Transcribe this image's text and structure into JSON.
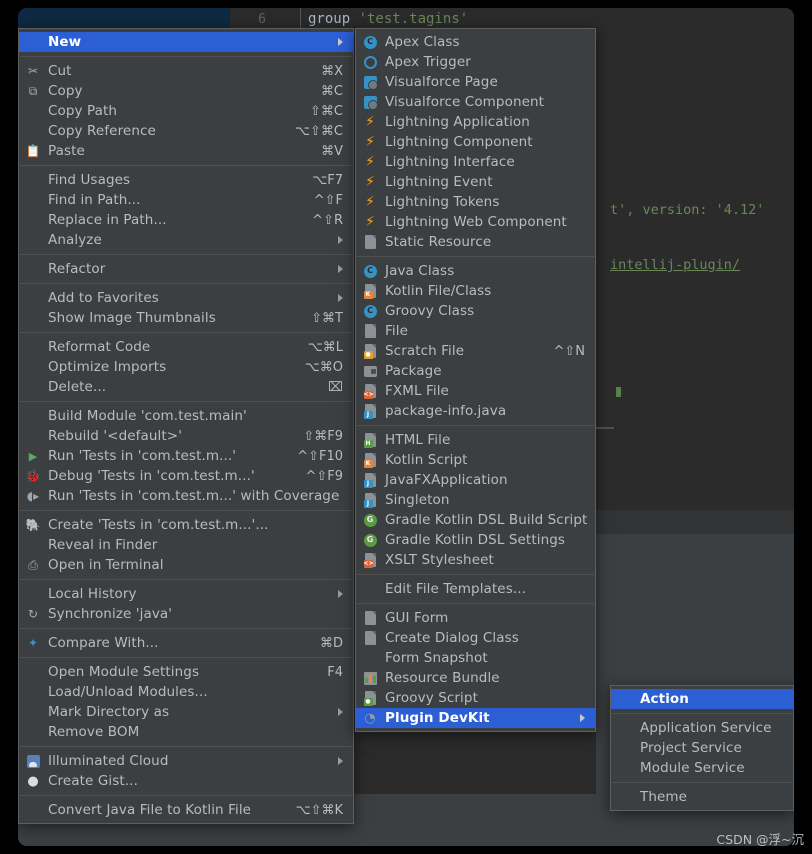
{
  "editor": {
    "top_line_number": "6",
    "top_code_prefix": "group ",
    "top_code_string": "'test.tagins'",
    "code_line_1": "t', version: '4.12'",
    "code_link": "intellij-plugin/"
  },
  "watermark": "CSDN @浮~沉",
  "colors": {
    "menu_bg": "#3c3f41",
    "menu_border": "#5e6060",
    "highlight": "#2d5fd4",
    "text": "#bbbbbb",
    "text_selected": "#ffffff",
    "separator": "#515151",
    "editor_bg": "#2b2b2b",
    "string_green": "#6a8759",
    "icon_blue": "#3592c4",
    "icon_orange": "#f5a623",
    "icon_green": "#59a869"
  },
  "context_menu": {
    "groups": [
      {
        "items": [
          {
            "label": "New",
            "icon": "none",
            "accel": "",
            "submenu": true,
            "selected": true
          }
        ]
      },
      {
        "items": [
          {
            "label": "Cut",
            "icon": "scissors-icon",
            "accel": "⌘X",
            "submenu": false
          },
          {
            "label": "Copy",
            "icon": "copy-icon",
            "accel": "⌘C",
            "submenu": false
          },
          {
            "label": "Copy Path",
            "icon": "none",
            "accel": "⇧⌘C",
            "submenu": false
          },
          {
            "label": "Copy Reference",
            "icon": "none",
            "accel": "⌥⇧⌘C",
            "submenu": false
          },
          {
            "label": "Paste",
            "icon": "paste-icon",
            "accel": "⌘V",
            "submenu": false
          }
        ]
      },
      {
        "items": [
          {
            "label": "Find Usages",
            "icon": "none",
            "accel": "⌥F7",
            "submenu": false
          },
          {
            "label": "Find in Path...",
            "icon": "none",
            "accel": "^⇧F",
            "submenu": false
          },
          {
            "label": "Replace in Path...",
            "icon": "none",
            "accel": "^⇧R",
            "submenu": false
          },
          {
            "label": "Analyze",
            "icon": "none",
            "accel": "",
            "submenu": true
          }
        ]
      },
      {
        "items": [
          {
            "label": "Refactor",
            "icon": "none",
            "accel": "",
            "submenu": true
          }
        ]
      },
      {
        "items": [
          {
            "label": "Add to Favorites",
            "icon": "none",
            "accel": "",
            "submenu": true
          },
          {
            "label": "Show Image Thumbnails",
            "icon": "none",
            "accel": "⇧⌘T",
            "submenu": false
          }
        ]
      },
      {
        "items": [
          {
            "label": "Reformat Code",
            "icon": "none",
            "accel": "⌥⌘L",
            "submenu": false
          },
          {
            "label": "Optimize Imports",
            "icon": "none",
            "accel": "⌥⌘O",
            "submenu": false
          },
          {
            "label": "Delete...",
            "icon": "none",
            "accel": "⌧",
            "submenu": false
          }
        ]
      },
      {
        "items": [
          {
            "label": "Build Module 'com.test.main'",
            "icon": "none",
            "accel": "",
            "submenu": false
          },
          {
            "label": "Rebuild '<default>'",
            "icon": "none",
            "accel": "⇧⌘F9",
            "submenu": false
          },
          {
            "label": "Run 'Tests in 'com.test.m...'",
            "icon": "run-icon",
            "accel": "^⇧F10",
            "submenu": false
          },
          {
            "label": "Debug 'Tests in 'com.test.m...'",
            "icon": "debug-icon",
            "accel": "^⇧F9",
            "submenu": false
          },
          {
            "label": "Run 'Tests in 'com.test.m...' with Coverage",
            "icon": "coverage-icon",
            "accel": "",
            "submenu": false
          }
        ]
      },
      {
        "items": [
          {
            "label": "Create 'Tests in 'com.test.m...'...",
            "icon": "gradle-icon",
            "accel": "",
            "submenu": false
          },
          {
            "label": "Reveal in Finder",
            "icon": "none",
            "accel": "",
            "submenu": false
          },
          {
            "label": "Open in Terminal",
            "icon": "terminal-icon",
            "accel": "",
            "submenu": false
          }
        ]
      },
      {
        "items": [
          {
            "label": "Local History",
            "icon": "none",
            "accel": "",
            "submenu": true
          },
          {
            "label": "Synchronize 'java'",
            "icon": "sync-icon",
            "accel": "",
            "submenu": false
          }
        ]
      },
      {
        "items": [
          {
            "label": "Compare With...",
            "icon": "compare-icon",
            "accel": "⌘D",
            "submenu": false
          }
        ]
      },
      {
        "items": [
          {
            "label": "Open Module Settings",
            "icon": "none",
            "accel": "F4",
            "submenu": false
          },
          {
            "label": "Load/Unload Modules...",
            "icon": "none",
            "accel": "",
            "submenu": false
          },
          {
            "label": "Mark Directory as",
            "icon": "none",
            "accel": "",
            "submenu": true
          },
          {
            "label": "Remove BOM",
            "icon": "none",
            "accel": "",
            "submenu": false
          }
        ]
      },
      {
        "items": [
          {
            "label": "Illuminated Cloud",
            "icon": "cloud-icon",
            "accel": "",
            "submenu": true
          },
          {
            "label": "Create Gist...",
            "icon": "github-icon",
            "accel": "",
            "submenu": false
          }
        ]
      },
      {
        "items": [
          {
            "label": "Convert Java File to Kotlin File",
            "icon": "none",
            "accel": "⌥⇧⌘K",
            "submenu": false
          }
        ]
      }
    ]
  },
  "new_menu": {
    "groups": [
      {
        "items": [
          {
            "label": "Apex Class",
            "icon": "apex-class-icon",
            "accel": "",
            "submenu": false
          },
          {
            "label": "Apex Trigger",
            "icon": "apex-trigger-icon",
            "accel": "",
            "submenu": false
          },
          {
            "label": "Visualforce Page",
            "icon": "visualforce-icon",
            "accel": "",
            "submenu": false
          },
          {
            "label": "Visualforce Component",
            "icon": "visualforce-icon",
            "accel": "",
            "submenu": false
          },
          {
            "label": "Lightning Application",
            "icon": "lightning-icon",
            "accel": "",
            "submenu": false
          },
          {
            "label": "Lightning Component",
            "icon": "lightning-icon",
            "accel": "",
            "submenu": false
          },
          {
            "label": "Lightning Interface",
            "icon": "lightning-icon",
            "accel": "",
            "submenu": false
          },
          {
            "label": "Lightning Event",
            "icon": "lightning-icon",
            "accel": "",
            "submenu": false
          },
          {
            "label": "Lightning Tokens",
            "icon": "lightning-icon",
            "accel": "",
            "submenu": false
          },
          {
            "label": "Lightning Web Component",
            "icon": "lightning-icon",
            "accel": "",
            "submenu": false
          },
          {
            "label": "Static Resource",
            "icon": "static-resource-icon",
            "accel": "",
            "submenu": false
          }
        ]
      },
      {
        "items": [
          {
            "label": "Java Class",
            "icon": "java-class-icon",
            "accel": "",
            "submenu": false
          },
          {
            "label": "Kotlin File/Class",
            "icon": "kotlin-file-icon",
            "accel": "",
            "submenu": false
          },
          {
            "label": "Groovy Class",
            "icon": "groovy-class-icon",
            "accel": "",
            "submenu": false
          },
          {
            "label": "File",
            "icon": "file-icon",
            "accel": "",
            "submenu": false
          },
          {
            "label": "Scratch File",
            "icon": "scratch-file-icon",
            "accel": "^⇧N",
            "submenu": false
          },
          {
            "label": "Package",
            "icon": "package-icon",
            "accel": "",
            "submenu": false
          },
          {
            "label": "FXML File",
            "icon": "fxml-file-icon",
            "accel": "",
            "submenu": false
          },
          {
            "label": "package-info.java",
            "icon": "java-file-icon",
            "accel": "",
            "submenu": false
          }
        ]
      },
      {
        "items": [
          {
            "label": "HTML File",
            "icon": "html-file-icon",
            "accel": "",
            "submenu": false
          },
          {
            "label": "Kotlin Script",
            "icon": "kotlin-script-icon",
            "accel": "",
            "submenu": false
          },
          {
            "label": "JavaFXApplication",
            "icon": "java-file-icon",
            "accel": "",
            "submenu": false
          },
          {
            "label": "Singleton",
            "icon": "java-file-icon",
            "accel": "",
            "submenu": false
          },
          {
            "label": "Gradle Kotlin DSL Build Script",
            "icon": "gradle-green-icon",
            "accel": "",
            "submenu": false
          },
          {
            "label": "Gradle Kotlin DSL Settings",
            "icon": "gradle-green-icon",
            "accel": "",
            "submenu": false
          },
          {
            "label": "XSLT Stylesheet",
            "icon": "xslt-file-icon",
            "accel": "",
            "submenu": false
          }
        ]
      },
      {
        "items": [
          {
            "label": "Edit File Templates...",
            "icon": "none",
            "accel": "",
            "submenu": false
          }
        ]
      },
      {
        "items": [
          {
            "label": "GUI Form",
            "icon": "gui-form-icon",
            "accel": "",
            "submenu": false
          },
          {
            "label": "Create Dialog Class",
            "icon": "gui-form-icon",
            "accel": "",
            "submenu": false
          },
          {
            "label": "Form Snapshot",
            "icon": "none",
            "accel": "",
            "submenu": false
          },
          {
            "label": "Resource Bundle",
            "icon": "resource-bundle-icon",
            "accel": "",
            "submenu": false
          },
          {
            "label": "Groovy Script",
            "icon": "groovy-script-icon",
            "accel": "",
            "submenu": false
          },
          {
            "label": "Plugin DevKit",
            "icon": "plugin-devkit-icon",
            "accel": "",
            "submenu": true,
            "selected": true
          }
        ]
      }
    ]
  },
  "devkit_menu": {
    "groups": [
      {
        "items": [
          {
            "label": "Action",
            "icon": "none",
            "accel": "",
            "submenu": false,
            "selected": true
          }
        ]
      },
      {
        "items": [
          {
            "label": "Application Service",
            "icon": "none",
            "accel": "",
            "submenu": false
          },
          {
            "label": "Project Service",
            "icon": "none",
            "accel": "",
            "submenu": false
          },
          {
            "label": "Module Service",
            "icon": "none",
            "accel": "",
            "submenu": false
          }
        ]
      },
      {
        "items": [
          {
            "label": "Theme",
            "icon": "none",
            "accel": "",
            "submenu": false
          }
        ]
      }
    ]
  }
}
